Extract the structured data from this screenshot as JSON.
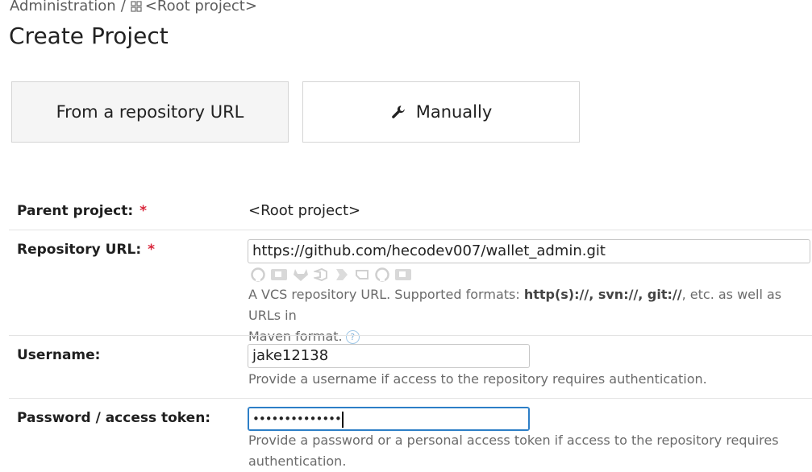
{
  "breadcrumb": {
    "root": "Administration",
    "separator": "/",
    "project": "<Root project>"
  },
  "page": {
    "title": "Create Project"
  },
  "tabs": [
    {
      "label": "From a repository URL",
      "selected": true
    },
    {
      "label": "Manually",
      "icon": "wrench-icon",
      "selected": false
    }
  ],
  "form": {
    "parent_project": {
      "label": "Parent project:",
      "required_mark": "*",
      "value": "<Root project>"
    },
    "repository_url": {
      "label": "Repository URL:",
      "required_mark": "*",
      "value": "https://github.com/hecodev007/wallet_admin.git",
      "vcs_icons": [
        "github-icon",
        "bitbucket-icon",
        "gitlab-icon",
        "azure-devops-icon",
        "bitbucket-server-icon",
        "space-icon",
        "github-enterprise-icon",
        "bitbucket-cloud-icon"
      ],
      "hint_prefix": "A VCS repository URL. Supported formats: ",
      "hint_formats": "http(s)://, svn://, git://",
      "hint_suffix": ", etc. as well as URLs in",
      "hint_line2": "Maven format."
    },
    "username": {
      "label": "Username:",
      "value": "jake12138",
      "hint": "Provide a username if access to the repository requires authentication."
    },
    "password": {
      "label": "Password / access token:",
      "masked_value": "••••••••••••••",
      "hint_line1": "Provide a password or a personal access token if access to the repository requires",
      "hint_line2": "authentication."
    }
  },
  "colors": {
    "required": "#d9263b",
    "focus_border": "#2d7fc7",
    "tab_selected_bg": "#f5f5f5"
  }
}
